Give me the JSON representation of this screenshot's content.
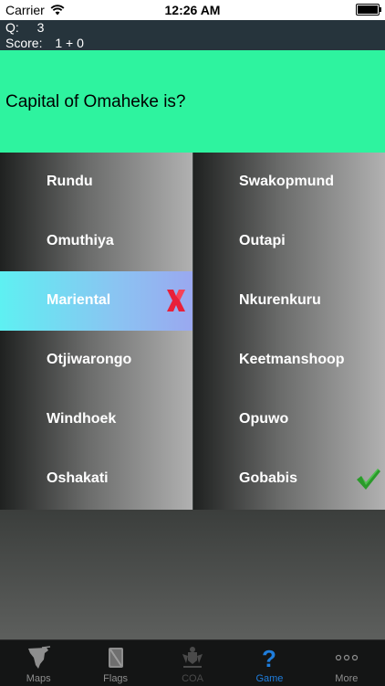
{
  "status_bar": {
    "carrier": "Carrier",
    "time": "12:26 AM"
  },
  "header": {
    "question_label": "Q:",
    "question_number": "3",
    "score_label": "Score:",
    "score_value": "1 + 0"
  },
  "question": {
    "text": "Capital of Omaheke is?"
  },
  "answers": {
    "left": [
      "Rundu",
      "Omuthiya",
      "Mariental",
      "Otjiwarongo",
      "Windhoek",
      "Oshakati"
    ],
    "right": [
      "Swakopmund",
      "Outapi",
      "Nkurenkuru",
      "Keetmanshoop",
      "Opuwo",
      "Gobabis"
    ],
    "wrong_selected": "Mariental",
    "correct_answer": "Gobabis"
  },
  "colors": {
    "question_bg": "#2ef39f",
    "header_bg": "#26343c",
    "wrong_mark": "#e8203a",
    "correct_mark": "#2a9a2a",
    "active_tab": "#1f7ddc"
  },
  "tabs": [
    {
      "label": "Maps",
      "icon": "map-icon",
      "state": "normal"
    },
    {
      "label": "Flags",
      "icon": "flag-icon",
      "state": "normal"
    },
    {
      "label": "COA",
      "icon": "coat-of-arms-icon",
      "state": "disabled"
    },
    {
      "label": "Game",
      "icon": "question-mark-icon",
      "state": "active"
    },
    {
      "label": "More",
      "icon": "more-dots-icon",
      "state": "normal"
    }
  ]
}
